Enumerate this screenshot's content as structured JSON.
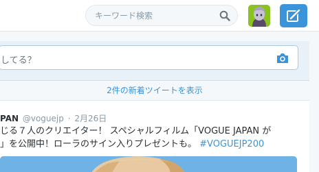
{
  "search": {
    "placeholder": "キーワード検索",
    "icon": "search-icon"
  },
  "profile": {
    "avatar": "avatar-image"
  },
  "tweet_button": {
    "icon": "compose-tweet-icon"
  },
  "compose": {
    "placeholder": "してる？",
    "camera_icon": "camera-icon"
  },
  "new_tweets": {
    "label": "2件の新着ツイートを表示"
  },
  "tweet": {
    "name": "PAN",
    "handle": "@voguejp",
    "separator": "·",
    "date": "2月26日",
    "line1": "じる７人のクリエイター！ スペシャルフィルム「VOGUE JAPAN が",
    "line2_text": "」を公開中！ローラのサイン入りプレゼントも。",
    "hashtag": "#VOGUEJP200"
  },
  "colors": {
    "accent": "#3b94d9",
    "link": "#3b94d9",
    "muted": "#8899a6",
    "text": "#292f33",
    "avatar_bg": "#8ac21f"
  }
}
